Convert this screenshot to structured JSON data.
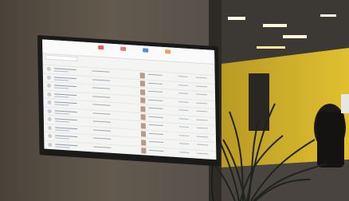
{
  "scene": {
    "description_colors": {
      "wall": "#5b5146",
      "yellow_room": "#d8b52a",
      "screen_bg": "#f4f4f2",
      "accent_red": "#e65c4f",
      "accent_blue": "#4a90d9",
      "accent_orange": "#f0a050"
    }
  },
  "app": {
    "tabs": [
      {
        "label": "",
        "icon": "red-square-icon"
      },
      {
        "label": "",
        "icon": "red-square-icon"
      },
      {
        "label": "",
        "icon": "blue-square-icon"
      },
      {
        "label": "",
        "icon": "orange-square-icon"
      }
    ],
    "search_placeholder": "",
    "rows": [
      1,
      2,
      3,
      4,
      5,
      6,
      7,
      8,
      9,
      10
    ]
  }
}
